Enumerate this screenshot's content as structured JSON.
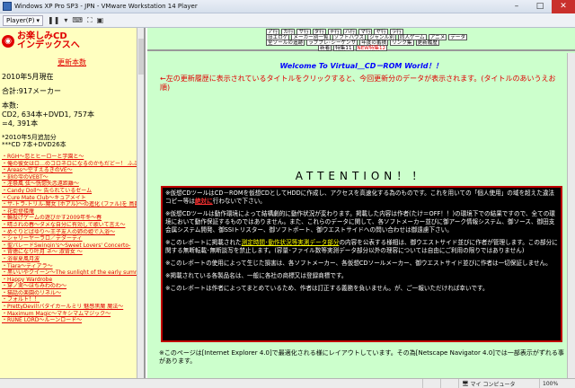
{
  "window": {
    "title": "Windows XP Pro SP3 - JPN - VMware Workstation 14 Player",
    "min": "–",
    "max": "□",
    "close": "✕"
  },
  "toolbar": {
    "player_menu": "Player(P)",
    "pause": "❚❚",
    "dropdown": "▾"
  },
  "left": {
    "logo_line1": "お楽しみCD",
    "logo_line2": "インデックスへ",
    "update_count_link": "更新本数",
    "as_of": "2010年5月現在",
    "makers": "合計:917メーカー",
    "count_label": "本数:",
    "count_line1": "CD2, 634本+DVD1, 757本",
    "count_line2": "=4, 391本",
    "added_label": "*2010年5月追加分",
    "added_count": "***CD 7本+DVD26本",
    "items": [
      "・RGH～恋とヒーローと学園と～",
      "・俺の彼女はロ…のコロネロになるのかもだどー！ ふぶき",
      "・Areas～空すえるきのVE～",
      "・刻の雫のVEBT～",
      "・淫祭風 弦～恍惚失恋遠距離～",
      "・Candy Doll～ 告られているゼーム",
      "・Cure Mate Club～キュアメイト",
      "・サ-トラ-トリル-魔女 (ホアル)～の進化 (ファル)を 鳥籠 (B)",
      "・花街登楼庵",
      "・輪投げゲームの遊びかす2009年冬～春",
      "・晴されの春～ダメな自分に有効しで歌いて言え～",
      "・めぐりどばゆり～王子友人の姉の姫で入浴～",
      "・シャリーヤーラロ／デダーディ",
      "・聖パレードSwingin's～Sweet Lovers' Concerto-",
      "・背徳になり叶月 ネ～ 淑背女 ～",
      "・浴翠夏風月波",
      "・Tiara～ティアラ～",
      "・黒いいやクイーン～The sunlight of the early summer to glitter honey～",
      "・Happy Wardrobe",
      "・穿ノ実～ほちみわのわ～",
      "・猫話の楽園のリネル～",
      "・フォルト！！",
      "・PrettyDevil!バタイカールミリ 魅感黒魔 魔法～",
      "・Maximum Magic～マキシマムマジック～",
      "・RUNE LORD～ルーンロード～"
    ]
  },
  "nav": {
    "row1": [
      "ア行",
      "カ行",
      "サ行",
      "タ行",
      "ナ行",
      "ハ行",
      "マ行",
      "ヤ行",
      "ラ行"
    ],
    "row2": [
      "旧エロゲ",
      "メーカー別一覧",
      "ソフトハウス",
      "ジャンル別",
      "同人ゲーム",
      "アニメ",
      "データ"
    ],
    "row3": [
      "全ソールの追跡",
      "ラブプレ･シーケンサ",
      "年度の蓄積",
      "リンク集",
      "更新履歴"
    ],
    "row4": [
      "新着",
      "特集11",
      "NEW特集12"
    ]
  },
  "main": {
    "welcome": "Welcome To Virtual＿CD－ROM World！！",
    "notice_a": "←左の更新履歴に表示されているタイトルをクリックすると、今回更新分のデータが表示されます。(タイトルのあいうえお順)",
    "notice_b": "",
    "attention": "ATTENTION！！",
    "p1a": "※仮想CDツールはCD－ROMを仮想CDとしてHDDに作成し、アクセスを高速化する為のものです。これを用いての「個人使用」の域を超えた違法コピー等は",
    "p1b": "絶対に",
    "p1c": "行わないで下さい。",
    "p2": "※仮想CDツールは動作環境によって結構劇的に動作状況が変わります。掲載した内容は作者(たけ＝OFF！！)の環境下での結果ですので、全ての環境において動作保証するものではありません。また、これらのデータに関して、各ソフトメーカー並びに御アーク情報システム、御ソース、御田支会属システム開発、御SSIトリスター、御ソフトボート、御ウエストサイドへの問い合わせは御遠慮下さい。",
    "p3a": "※このレポートに掲載された",
    "p3b": "測定時間･動作状況等実測データ部分",
    "p3c": "の内容を公表する様相は、御ウエストサイド並びに作者が管理します。この部分に関する無断転載･無断談写を禁止します。(容量･ファイル数等実測データ部分以外の理容については自由にご利用の限りではありません)",
    "p4": "※このレポートの使用によって生じた損害は、各ソフトメーカー、各仮想CDソールメーカー、御ウエストサイド並びに作者は一切保証しません。",
    "p5": "※掲載されている各製品名は、一般に各社の商標又は登録商標です。",
    "p6": "※このレポートは作者によってまとめているため、作者は訂正する義務を負いません。が、ご一報いただければ幸いです。",
    "footnote": "※このページは[Internet Explorer 4.0]で最適化される様にレイアウトしています。その為[Netscape Navigator 4.0]では一部表示がずれる事があります。"
  },
  "status": {
    "zone": "マイ コンピュータ",
    "zoom": "100%"
  }
}
